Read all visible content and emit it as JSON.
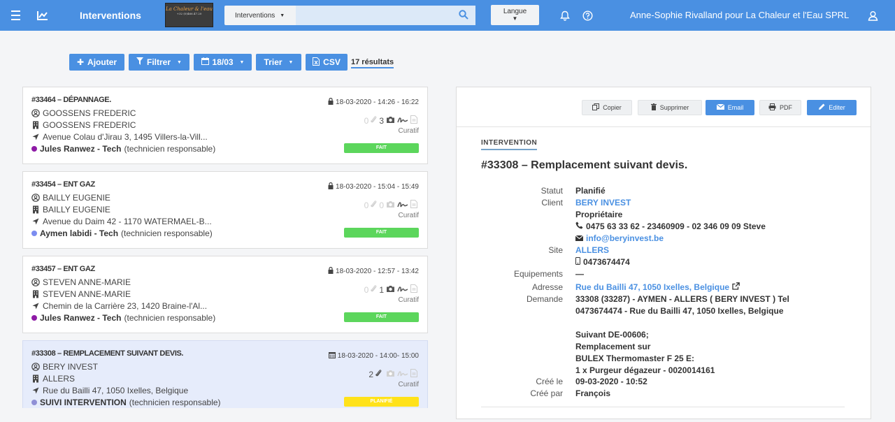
{
  "nav": {
    "title": "Interventions",
    "logo_text": "La Chaleur & l'eau",
    "logo_phone": "+32 (0)466.47.20",
    "search_scope": "Interventions",
    "search_value": "",
    "language_label": "Langue",
    "user": "Anne-Sophie Rivalland pour La Chaleur et l'Eau SPRL"
  },
  "toolbar": {
    "add": "Ajouter",
    "filter": "Filtrer",
    "date": "18/03",
    "sort": "Trier",
    "csv": "CSV",
    "results": "17 résultats"
  },
  "cards": [
    {
      "title": "#33464 – DÉPANNAGE.",
      "client": "GOOSSENS FREDERIC",
      "site": "GOOSSENS FREDERIC",
      "address": "Avenue Colau d'Jirau 3, 1495 Villers-la-Vill...",
      "tech": "Jules Ranwez - Tech",
      "tech_role": "(technicien responsable)",
      "tech_color": "#8e1ba6",
      "date": "18-03-2020 - 14:26 - 16:22",
      "attachments": "0",
      "photos": "3",
      "type": "Curatif",
      "status": "FAIT",
      "status_color": "#5cd65c"
    },
    {
      "title": "#33454 – ENT GAZ",
      "client": "BAILLY EUGENIE",
      "site": "BAILLY EUGENIE",
      "address": "Avenue du Daim 42 - 1170 WATERMAEL-B...",
      "tech": "Aymen labidi - Tech",
      "tech_role": "(technicien responsable)",
      "tech_color": "#7b8cf0",
      "date": "18-03-2020 - 15:04 - 15:49",
      "attachments": "0",
      "photos": "0",
      "type": "Curatif",
      "status": "FAIT",
      "status_color": "#5cd65c"
    },
    {
      "title": "#33457 – ENT GAZ",
      "client": "STEVEN ANNE-MARIE",
      "site": "STEVEN ANNE-MARIE",
      "address": "Chemin de la Carrière 23, 1420 Braine-l'Al...",
      "tech": "Jules Ranwez - Tech",
      "tech_role": "(technicien responsable)",
      "tech_color": "#8e1ba6",
      "date": "18-03-2020 - 12:57 - 13:42",
      "attachments": "0",
      "photos": "1",
      "type": "Curatif",
      "status": "FAIT",
      "status_color": "#5cd65c"
    },
    {
      "title": "#33308 – REMPLACEMENT SUIVANT DEVIS.",
      "client": "BERY INVEST",
      "site": "ALLERS",
      "address": "Rue du Bailli 47, 1050 Ixelles, Belgique",
      "tech": "SUIVI INTERVENTION",
      "tech_role": "(technicien responsable)",
      "tech_color": "#8f8fd6",
      "date": "18-03-2020 - 14:00- 15:00",
      "attachments": "2",
      "photos": "",
      "type": "Curatif",
      "status": "PLANIFIÉ",
      "status_color": "#ffe21a"
    }
  ],
  "detail": {
    "actions": {
      "copy": "Copier",
      "delete": "Supprimer",
      "email": "Email",
      "pdf": "PDF",
      "edit": "Editer"
    },
    "section": "INTERVENTION",
    "title": "#33308 – Remplacement suivant devis.",
    "labels": {
      "status": "Statut",
      "client": "Client",
      "site": "Site",
      "equipment": "Equipements",
      "address": "Adresse",
      "request": "Demande",
      "created_on": "Créé le",
      "created_by": "Créé par"
    },
    "status": "Planifié",
    "client": "BERY INVEST",
    "client_role": "Propriétaire",
    "client_phone": "0475 63 33 62 - 23460909 - 02 346 09 09 Steve",
    "client_email": "info@beryinvest.be",
    "site": "ALLERS",
    "site_phone": "0473674474",
    "equipment": "—",
    "address": "Rue du Bailli 47, 1050 Ixelles, Belgique",
    "request_lines": [
      "33308 (33287) - AYMEN - ALLERS ( BERY INVEST ) Tel",
      "0473674474 - Rue du Bailli 47, 1050 Ixelles, Belgique",
      "",
      "Suivant DE-00606;",
      "Remplacement sur",
      "BULEX Thermomaster F 25 E:",
      "1 x Purgeur dégazeur - 0020014161"
    ],
    "created_on": "09-03-2020 - 10:52",
    "created_by": "François"
  },
  "colors": {
    "primary": "#4a90e2",
    "done": "#5cd65c",
    "planned": "#ffe21a",
    "selected_bg": "#e6ecfb"
  }
}
